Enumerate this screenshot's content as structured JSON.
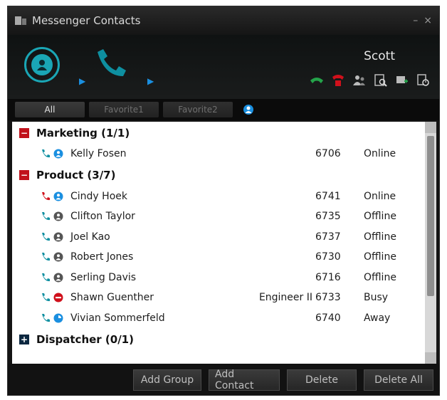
{
  "window": {
    "title": "Messenger Contacts",
    "minimize": "–",
    "close": "×"
  },
  "user": {
    "name": "Scott"
  },
  "tabs": [
    {
      "label": "All"
    },
    {
      "label": "Favorite1"
    },
    {
      "label": "Favorite2"
    }
  ],
  "groups": [
    {
      "label": "Marketing (1/1)",
      "toggle": "−",
      "contacts": [
        {
          "name": "Kelly Fosen",
          "title": "",
          "ext": "6706",
          "status": "Online"
        }
      ]
    },
    {
      "label": "Product (3/7)",
      "toggle": "−",
      "contacts": [
        {
          "name": "Cindy Hoek",
          "title": "",
          "ext": "6741",
          "status": "Online"
        },
        {
          "name": "Clifton Taylor",
          "title": "",
          "ext": "6735",
          "status": "Offline"
        },
        {
          "name": "Joel Kao",
          "title": "",
          "ext": "6737",
          "status": "Offline"
        },
        {
          "name": "Robert Jones",
          "title": "",
          "ext": "6730",
          "status": "Offline"
        },
        {
          "name": "Serling Davis",
          "title": "",
          "ext": "6716",
          "status": "Offline"
        },
        {
          "name": "Shawn Guenther",
          "title": "Engineer II",
          "ext": "6733",
          "status": "Busy"
        },
        {
          "name": "Vivian Sommerfeld",
          "title": "",
          "ext": "6740",
          "status": "Away"
        }
      ]
    },
    {
      "label": "Dispatcher (0/1)",
      "toggle": "+",
      "contacts": []
    }
  ],
  "buttons": {
    "add_group": "Add Group",
    "add_contact": "Add Contact",
    "delete": "Delete",
    "delete_all": "Delete All"
  },
  "colors": {
    "online": "#1a8fe0",
    "offline": "#555555",
    "busy": "#d0101b",
    "away": "#1a8fe0",
    "accent": "#1aa6b5"
  }
}
